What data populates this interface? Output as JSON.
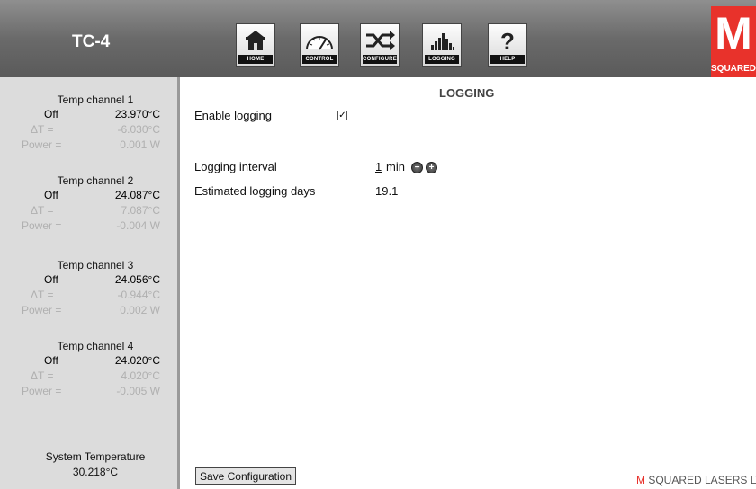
{
  "app": {
    "title": "TC-4"
  },
  "nav": [
    {
      "label": "HOME",
      "icon": "home-icon"
    },
    {
      "label": "CONTROL",
      "icon": "gauge-icon"
    },
    {
      "label": "CONFIGURE",
      "icon": "shuffle-icon"
    },
    {
      "label": "LOGGING",
      "icon": "bar-chart-icon"
    },
    {
      "label": "HELP",
      "icon": "question-icon"
    }
  ],
  "logo": {
    "letter": "M",
    "text": "SQUARED",
    "color": "#e8322b"
  },
  "channels": [
    {
      "title": "Temp channel 1",
      "state": "Off",
      "temp": "23.970°C",
      "delta_label": "ΔT =",
      "delta": "-6.030°C",
      "power_label": "Power =",
      "power": "0.001 W"
    },
    {
      "title": "Temp channel 2",
      "state": "Off",
      "temp": "24.087°C",
      "delta_label": "ΔT =",
      "delta": "7.087°C",
      "power_label": "Power =",
      "power": "-0.004 W"
    },
    {
      "title": "Temp channel 3",
      "state": "Off",
      "temp": "24.056°C",
      "delta_label": "ΔT =",
      "delta": "-0.944°C",
      "power_label": "Power =",
      "power": "0.002 W"
    },
    {
      "title": "Temp channel 4",
      "state": "Off",
      "temp": "24.020°C",
      "delta_label": "ΔT =",
      "delta": "4.020°C",
      "power_label": "Power =",
      "power": "-0.005 W"
    }
  ],
  "system": {
    "label": "System Temperature",
    "value": "30.218°C"
  },
  "page": {
    "title": "LOGGING",
    "enable_label": "Enable logging",
    "enable_checked": true,
    "interval_label": "Logging interval",
    "interval_value": "1",
    "interval_unit": "min",
    "days_label": "Estimated logging days",
    "days_value": "19.1",
    "save_label": "Save Configuration"
  },
  "footer": {
    "mark": "M",
    "text": " SQUARED LASERS LTD"
  }
}
